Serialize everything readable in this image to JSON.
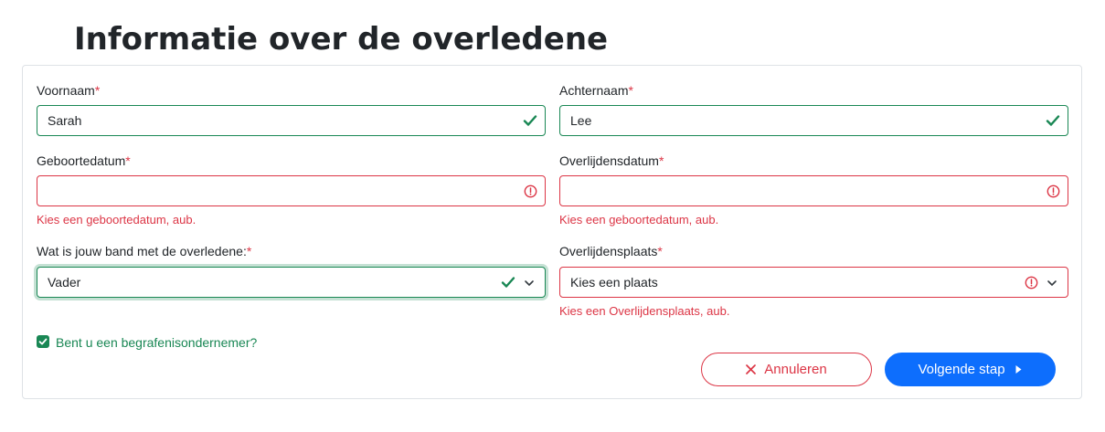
{
  "page": {
    "title": "Informatie over de overledene"
  },
  "form": {
    "required_marker": "*",
    "first_name": {
      "label": "Voornaam",
      "value": "Sarah",
      "state": "valid"
    },
    "last_name": {
      "label": "Achternaam",
      "value": "Lee",
      "state": "valid"
    },
    "birth_date": {
      "label": "Geboortedatum",
      "value": "",
      "state": "invalid",
      "error": "Kies een geboortedatum, aub."
    },
    "death_date": {
      "label": "Overlijdensdatum",
      "value": "",
      "state": "invalid",
      "error": "Kies een geboortedatum, aub."
    },
    "relation": {
      "label": "Wat is jouw band met de overledene:",
      "value": "Vader",
      "state": "valid"
    },
    "death_place": {
      "label": "Overlijdensplaats",
      "value": "Kies een plaats",
      "state": "invalid",
      "error": "Kies een Overlijdensplaats, aub."
    },
    "funeral_director": {
      "label": "Bent u een begrafenisondernemer?",
      "checked": true
    }
  },
  "actions": {
    "cancel_label": "Annuleren",
    "next_label": "Volgende stap"
  },
  "colors": {
    "valid": "#198754",
    "invalid": "#dc3545",
    "primary": "#0d6efd"
  },
  "icons": {
    "valid": "check-icon",
    "invalid": "alert-circle-icon",
    "dropdown": "chevron-down-icon",
    "cancel": "close-icon",
    "next": "caret-right-icon"
  }
}
